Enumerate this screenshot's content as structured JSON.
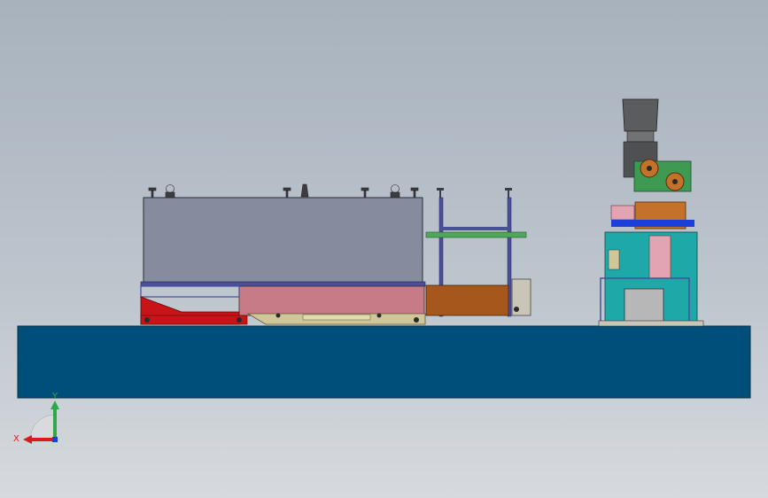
{
  "viewport": {
    "background_top": "#a8b2bd",
    "background_bottom": "#d6dade"
  },
  "model": {
    "base_color": "#004f7a",
    "tank_color": "#868b9e",
    "tank_lower_color": "#c77b86",
    "sled_red": "#c81418",
    "rail_color": "#4a4f9c",
    "green_plate": "#4fa85a",
    "brown_box": "#a5571c",
    "cabinet_teal": "#1ea8a8",
    "motor_dark": "#5a5c5e",
    "copper": "#c4712a",
    "green_board": "#3e9a52"
  },
  "triad": {
    "x_label": "X",
    "y_label": "Y",
    "x_color": "#d81b20",
    "y_color": "#2fa84a",
    "z_color": "#1b3fd8"
  }
}
